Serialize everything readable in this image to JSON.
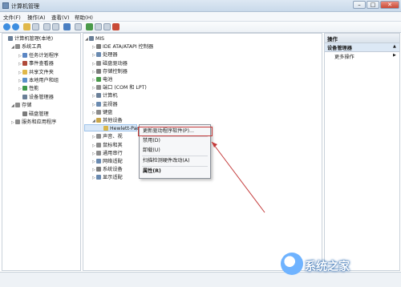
{
  "window": {
    "title": "计算机管理"
  },
  "menu": [
    "文件(F)",
    "操作(A)",
    "查看(V)",
    "帮助(H)"
  ],
  "left_tree": [
    {
      "label": "计算机管理(本地)",
      "indent": 0,
      "exp": "",
      "color": "#6a7f98"
    },
    {
      "label": "系统工具",
      "indent": 1,
      "exp": "◢",
      "color": "#8c8c8c"
    },
    {
      "label": "任务计划程序",
      "indent": 2,
      "exp": "▷",
      "color": "#5b86c4"
    },
    {
      "label": "事件查看器",
      "indent": 2,
      "exp": "▷",
      "color": "#b04a3a"
    },
    {
      "label": "共享文件夹",
      "indent": 2,
      "exp": "▷",
      "color": "#e0b84a"
    },
    {
      "label": "本地用户和组",
      "indent": 2,
      "exp": "▷",
      "color": "#5a8fc8"
    },
    {
      "label": "性能",
      "indent": 2,
      "exp": "▷",
      "color": "#3f9a4a"
    },
    {
      "label": "设备管理器",
      "indent": 2,
      "exp": "",
      "color": "#6a7f98"
    },
    {
      "label": "存储",
      "indent": 1,
      "exp": "◢",
      "color": "#8c8c8c"
    },
    {
      "label": "磁盘管理",
      "indent": 2,
      "exp": "",
      "color": "#7b7b7b"
    },
    {
      "label": "服务和应用程序",
      "indent": 1,
      "exp": "▷",
      "color": "#8c8c8c"
    }
  ],
  "device_tree": [
    {
      "label": "MIS",
      "indent": 0,
      "exp": "◢",
      "color": "#6a7f98"
    },
    {
      "label": "IDE ATA/ATAPI 控制器",
      "indent": 1,
      "exp": "▷",
      "color": "#7b7b7b"
    },
    {
      "label": "处理器",
      "indent": 1,
      "exp": "▷",
      "color": "#6a8ab0"
    },
    {
      "label": "磁盘驱动器",
      "indent": 1,
      "exp": "▷",
      "color": "#8c8c8c"
    },
    {
      "label": "存储控制器",
      "indent": 1,
      "exp": "▷",
      "color": "#7b7b7b"
    },
    {
      "label": "电池",
      "indent": 1,
      "exp": "▷",
      "color": "#4a9a4a"
    },
    {
      "label": "端口 (COM 和 LPT)",
      "indent": 1,
      "exp": "▷",
      "color": "#8c8c8c"
    },
    {
      "label": "计算机",
      "indent": 1,
      "exp": "▷",
      "color": "#6a7f98"
    },
    {
      "label": "监视器",
      "indent": 1,
      "exp": "▷",
      "color": "#6a8ab0"
    },
    {
      "label": "键盘",
      "indent": 1,
      "exp": "▷",
      "color": "#8c8c8c"
    },
    {
      "label": "其他设备",
      "indent": 1,
      "exp": "◢",
      "color": "#c9a64a"
    },
    {
      "label": "Hewlett-Packard",
      "indent": 2,
      "exp": "",
      "color": "#d8b54a"
    },
    {
      "label": "声音、视",
      "indent": 1,
      "exp": "▷",
      "color": "#8c8c8c"
    },
    {
      "label": "鼠标和其",
      "indent": 1,
      "exp": "▷",
      "color": "#8c8c8c"
    },
    {
      "label": "通用串行",
      "indent": 1,
      "exp": "▷",
      "color": "#8c8c8c"
    },
    {
      "label": "网络适配",
      "indent": 1,
      "exp": "▷",
      "color": "#6a8ab0"
    },
    {
      "label": "系统设备",
      "indent": 1,
      "exp": "▷",
      "color": "#7b7b7b"
    },
    {
      "label": "显示适配",
      "indent": 1,
      "exp": "▷",
      "color": "#6a8ab0"
    }
  ],
  "actions": {
    "header": "操作",
    "section": "设备管理器",
    "more": "更多操作"
  },
  "context_menu": {
    "items": [
      "更新驱动程序软件(P)...",
      "禁用(D)",
      "卸载(U)",
      "扫描检测硬件改动(A)",
      "属性(R)"
    ]
  },
  "watermark": {
    "text": "系统之家"
  },
  "colors": {
    "highlight": "#c43a3a",
    "selection": "#3d8ee0"
  }
}
